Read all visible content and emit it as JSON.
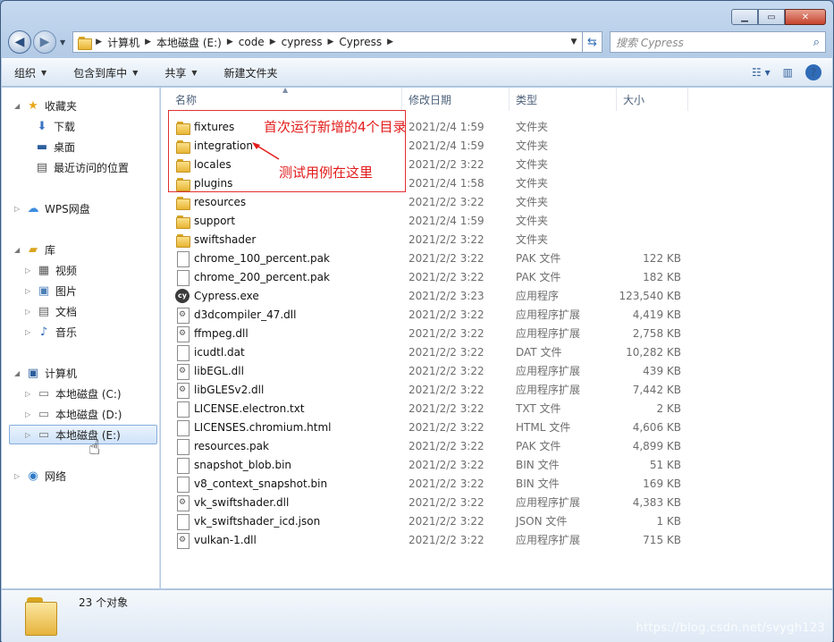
{
  "window": {
    "caption_buttons": [
      "minimize-icon",
      "maximize-icon",
      "close-icon"
    ]
  },
  "address_bar": {
    "segments": [
      "计算机",
      "本地磁盘 (E:)",
      "code",
      "cypress",
      "Cypress"
    ],
    "search_placeholder": "搜索 Cypress"
  },
  "toolbar": {
    "organize": "组织",
    "include_in_library": "包含到库中",
    "share": "共享",
    "new_folder": "新建文件夹"
  },
  "nav_pane": {
    "favorites": "收藏夹",
    "downloads": "下载",
    "desktop": "桌面",
    "recent": "最近访问的位置",
    "wps": "WPS网盘",
    "libraries": "库",
    "videos": "视频",
    "pictures": "图片",
    "documents": "文档",
    "music": "音乐",
    "computer": "计算机",
    "drive_c": "本地磁盘 (C:)",
    "drive_d": "本地磁盘 (D:)",
    "drive_e": "本地磁盘 (E:)",
    "network": "网络"
  },
  "columns": {
    "name": "名称",
    "date": "修改日期",
    "type": "类型",
    "size": "大小"
  },
  "files": [
    {
      "name": "fixtures",
      "date": "2021/2/4 1:59",
      "type": "文件夹",
      "size": "",
      "icon": "folder"
    },
    {
      "name": "integration",
      "date": "2021/2/4 1:59",
      "type": "文件夹",
      "size": "",
      "icon": "folder"
    },
    {
      "name": "locales",
      "date": "2021/2/2 3:22",
      "type": "文件夹",
      "size": "",
      "icon": "folder"
    },
    {
      "name": "plugins",
      "date": "2021/2/4 1:58",
      "type": "文件夹",
      "size": "",
      "icon": "folder"
    },
    {
      "name": "resources",
      "date": "2021/2/2 3:22",
      "type": "文件夹",
      "size": "",
      "icon": "folder"
    },
    {
      "name": "support",
      "date": "2021/2/4 1:59",
      "type": "文件夹",
      "size": "",
      "icon": "folder"
    },
    {
      "name": "swiftshader",
      "date": "2021/2/2 3:22",
      "type": "文件夹",
      "size": "",
      "icon": "folder"
    },
    {
      "name": "chrome_100_percent.pak",
      "date": "2021/2/2 3:22",
      "type": "PAK 文件",
      "size": "122 KB",
      "icon": "doc"
    },
    {
      "name": "chrome_200_percent.pak",
      "date": "2021/2/2 3:22",
      "type": "PAK 文件",
      "size": "182 KB",
      "icon": "doc"
    },
    {
      "name": "Cypress.exe",
      "date": "2021/2/2 3:23",
      "type": "应用程序",
      "size": "123,540 KB",
      "icon": "exe"
    },
    {
      "name": "d3dcompiler_47.dll",
      "date": "2021/2/2 3:22",
      "type": "应用程序扩展",
      "size": "4,419 KB",
      "icon": "dll"
    },
    {
      "name": "ffmpeg.dll",
      "date": "2021/2/2 3:22",
      "type": "应用程序扩展",
      "size": "2,758 KB",
      "icon": "dll"
    },
    {
      "name": "icudtl.dat",
      "date": "2021/2/2 3:22",
      "type": "DAT 文件",
      "size": "10,282 KB",
      "icon": "doc"
    },
    {
      "name": "libEGL.dll",
      "date": "2021/2/2 3:22",
      "type": "应用程序扩展",
      "size": "439 KB",
      "icon": "dll"
    },
    {
      "name": "libGLESv2.dll",
      "date": "2021/2/2 3:22",
      "type": "应用程序扩展",
      "size": "7,442 KB",
      "icon": "dll"
    },
    {
      "name": "LICENSE.electron.txt",
      "date": "2021/2/2 3:22",
      "type": "TXT 文件",
      "size": "2 KB",
      "icon": "doc"
    },
    {
      "name": "LICENSES.chromium.html",
      "date": "2021/2/2 3:22",
      "type": "HTML 文件",
      "size": "4,606 KB",
      "icon": "doc"
    },
    {
      "name": "resources.pak",
      "date": "2021/2/2 3:22",
      "type": "PAK 文件",
      "size": "4,899 KB",
      "icon": "doc"
    },
    {
      "name": "snapshot_blob.bin",
      "date": "2021/2/2 3:22",
      "type": "BIN 文件",
      "size": "51 KB",
      "icon": "doc"
    },
    {
      "name": "v8_context_snapshot.bin",
      "date": "2021/2/2 3:22",
      "type": "BIN 文件",
      "size": "169 KB",
      "icon": "doc"
    },
    {
      "name": "vk_swiftshader.dll",
      "date": "2021/2/2 3:22",
      "type": "应用程序扩展",
      "size": "4,383 KB",
      "icon": "dll"
    },
    {
      "name": "vk_swiftshader_icd.json",
      "date": "2021/2/2 3:22",
      "type": "JSON 文件",
      "size": "1 KB",
      "icon": "doc"
    },
    {
      "name": "vulkan-1.dll",
      "date": "2021/2/2 3:22",
      "type": "应用程序扩展",
      "size": "715 KB",
      "icon": "dll"
    }
  ],
  "annotations": {
    "note1": "首次运行新增的4个目录",
    "note2": "测试用例在这里",
    "color": "#e21b1b"
  },
  "details": {
    "item_count": "23 个对象"
  },
  "watermark": "https://blog.csdn.net/svygh123"
}
